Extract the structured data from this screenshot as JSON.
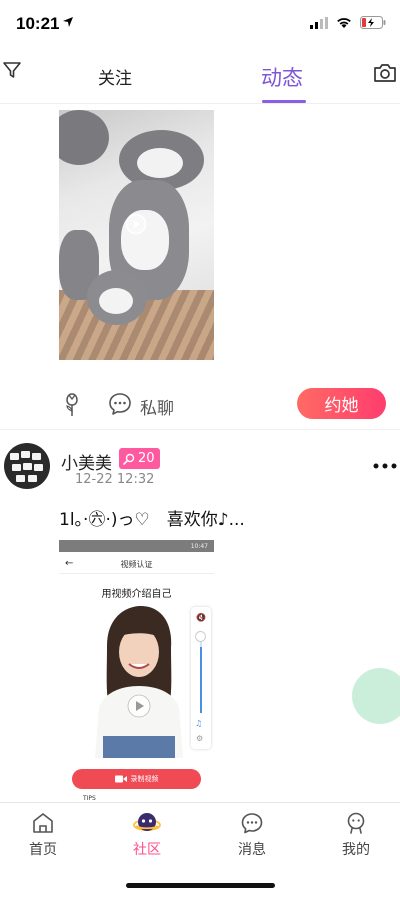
{
  "status_bar": {
    "time": "10:21"
  },
  "top_nav": {
    "tabs": [
      {
        "label": "关注",
        "active": false
      },
      {
        "label": "动态",
        "active": true
      }
    ],
    "accent_color": "#7e55d8"
  },
  "post1": {
    "actions": {
      "chat_label": "私聊",
      "date_label": "约她"
    }
  },
  "post2": {
    "username": "小美美",
    "level": "20",
    "time": "12-22 12:32",
    "text": "1l。·㊅·)っ♡　喜欢你♪...",
    "embedded_screenshot": {
      "status_right": "10:47",
      "title": "视频认证",
      "heading": "用视频介绍自己",
      "record_label": "录制视频",
      "tips_label": "TIPS"
    }
  },
  "tab_bar": {
    "items": [
      {
        "label": "首页",
        "icon": "home-icon",
        "active": false
      },
      {
        "label": "社区",
        "icon": "community-icon",
        "active": true
      },
      {
        "label": "消息",
        "icon": "message-icon",
        "active": false
      },
      {
        "label": "我的",
        "icon": "profile-icon",
        "active": false
      }
    ],
    "active_color": "#ff4f8b"
  }
}
